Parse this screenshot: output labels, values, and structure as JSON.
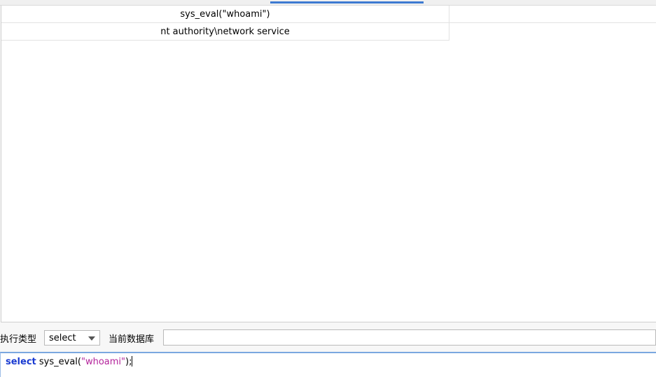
{
  "result_grid": {
    "column_header": "sys_eval(\"whoami\")",
    "rows": [
      "nt authority\\network service"
    ]
  },
  "toolbar": {
    "exec_type_label": "执行类型",
    "exec_type_value": "select",
    "current_db_label": "当前数据库",
    "current_db_value": ""
  },
  "editor": {
    "keyword": "select",
    "func": " sys_eval(",
    "string": "\"whoami\"",
    "tail": ");"
  },
  "colors": {
    "accent": "#3d7ad1",
    "keyword": "#1a3bd1",
    "string": "#b4239b"
  }
}
